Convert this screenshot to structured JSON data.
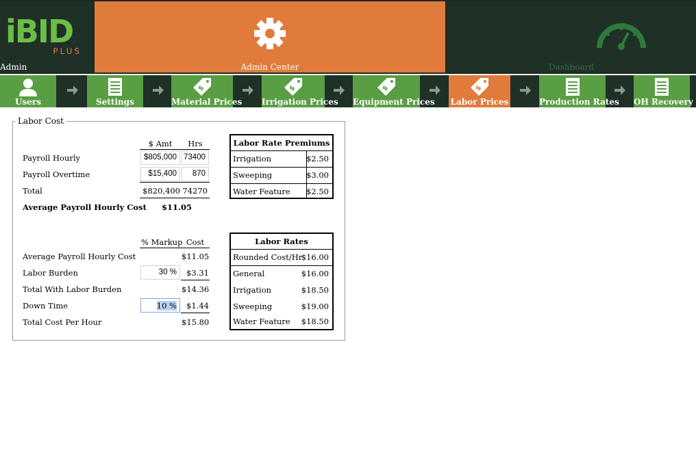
{
  "header": {
    "logo_text": "iBID",
    "logo_sub": "PLUS",
    "admin_label": "Admin",
    "admin_center_label": "Admin Center",
    "dashboard_label": "Dashboard"
  },
  "nav": {
    "tabs": [
      {
        "label": "Users",
        "icon": "user-icon"
      },
      {
        "label": "Settings",
        "icon": "document-icon"
      },
      {
        "label": "Material Prices",
        "icon": "price-tag-icon"
      },
      {
        "label": "Irrigation Prices",
        "icon": "price-tag-icon"
      },
      {
        "label": "Equipment Prices",
        "icon": "price-tag-icon"
      },
      {
        "label": "Labor Prices",
        "icon": "price-tag-icon"
      },
      {
        "label": "Production Rates",
        "icon": "document-icon"
      },
      {
        "label": "OH Recovery",
        "icon": "document-icon"
      }
    ],
    "active": "Labor Prices"
  },
  "labor_cost": {
    "title": "Labor Cost",
    "payroll": {
      "col_amt": "$ Amt",
      "col_hrs": "Hrs",
      "rows": [
        {
          "label": "Payroll Hourly",
          "amt": "$805,000",
          "hrs": "73400"
        },
        {
          "label": "Payroll Overtime",
          "amt": "$15,400",
          "hrs": "870"
        },
        {
          "label": "Total",
          "amt": "$820,400",
          "hrs": "74270"
        }
      ],
      "avg_label": "Average Payroll Hourly Cost",
      "avg_value": "$11.05"
    },
    "markup": {
      "col_markup": "% Markup",
      "col_cost": "Cost",
      "rows": [
        {
          "label": "Average Payroll Hourly Cost",
          "markup": "",
          "cost": "$11.05"
        },
        {
          "label": "Labor Burden",
          "markup": "30 %",
          "cost": "$3.31"
        },
        {
          "label": "Total With Labor Burden",
          "markup": "",
          "cost": "$14.36"
        },
        {
          "label": "Down Time",
          "markup": "10 %",
          "cost": "$1.44"
        },
        {
          "label": "Total Cost Per Hour",
          "markup": "",
          "cost": "$15.80"
        }
      ]
    },
    "premiums": {
      "title": "Labor Rate Premiums",
      "rows": [
        {
          "label": "Irrigation",
          "value": "$2.50"
        },
        {
          "label": "Sweeping",
          "value": "$3.00"
        },
        {
          "label": "Water Feature",
          "value": "$2.50"
        }
      ]
    },
    "rates": {
      "title": "Labor Rates",
      "rows": [
        {
          "label": "Rounded Cost/Hr",
          "value": "$16.00"
        },
        {
          "label": "General",
          "value": "$16.00"
        },
        {
          "label": "Irrigation",
          "value": "$18.50"
        },
        {
          "label": "Sweeping",
          "value": "$19.00"
        },
        {
          "label": "Water Feature",
          "value": "$18.50"
        }
      ]
    }
  },
  "colors": {
    "brand_green": "#5a9e44",
    "brand_orange": "#e07b3c",
    "dark_bg": "#1f3027"
  }
}
